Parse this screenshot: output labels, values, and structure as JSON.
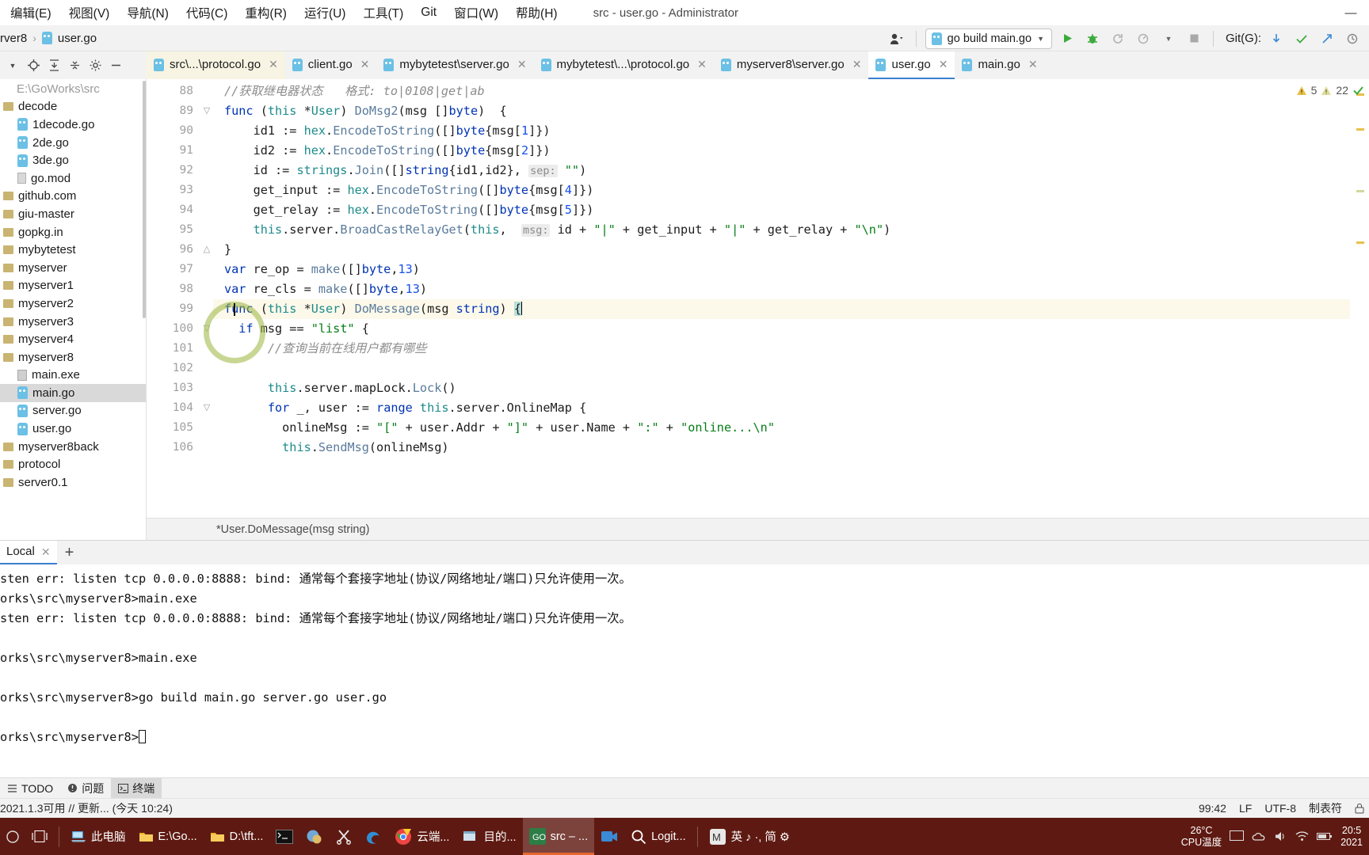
{
  "window": {
    "title": "src - user.go - Administrator",
    "minimize_label": "—",
    "maximize_label": "☐",
    "close_label": "✕"
  },
  "menubar": {
    "items": [
      {
        "label": "编辑(E)",
        "name": "menu-edit"
      },
      {
        "label": "视图(V)",
        "name": "menu-view"
      },
      {
        "label": "导航(N)",
        "name": "menu-navigate"
      },
      {
        "label": "代码(C)",
        "name": "menu-code"
      },
      {
        "label": "重构(R)",
        "name": "menu-refactor"
      },
      {
        "label": "运行(U)",
        "name": "menu-run"
      },
      {
        "label": "工具(T)",
        "name": "menu-tools"
      },
      {
        "label": "Git",
        "name": "menu-git"
      },
      {
        "label": "窗口(W)",
        "name": "menu-window"
      },
      {
        "label": "帮助(H)",
        "name": "menu-help"
      }
    ]
  },
  "navbar": {
    "breadcrumb": [
      {
        "label": "rver8",
        "name": "breadcrumb-project"
      },
      {
        "label": "user.go",
        "name": "breadcrumb-file"
      }
    ],
    "separator": "›",
    "run_config": "go build main.go",
    "run_config_caret": "▼",
    "git_label": "Git(G):",
    "actions": [
      "run-button",
      "debug-button",
      "rerun-button",
      "coverage-button",
      "more-caret",
      "stop-button"
    ],
    "git_actions": [
      "git-update-button",
      "git-commit-button",
      "git-push-button",
      "git-history-button"
    ]
  },
  "tabs": [
    {
      "label": "src\\...\\protocol.go",
      "state": "highlight",
      "name": "tab-src-protocol"
    },
    {
      "label": "client.go",
      "state": "normal",
      "name": "tab-client"
    },
    {
      "label": "mybytetest\\server.go",
      "state": "normal",
      "name": "tab-mybytetest-server"
    },
    {
      "label": "mybytetest\\...\\protocol.go",
      "state": "normal",
      "name": "tab-mybytetest-protocol"
    },
    {
      "label": "myserver8\\server.go",
      "state": "normal",
      "name": "tab-myserver8-server"
    },
    {
      "label": "user.go",
      "state": "active",
      "name": "tab-user"
    },
    {
      "label": "main.go",
      "state": "normal",
      "name": "tab-main"
    }
  ],
  "toolbar_icons": [
    "project-caret",
    "locate-icon",
    "expand-all-icon",
    "collapse-all-icon",
    "settings-icon",
    "hide-icon"
  ],
  "sidebar": {
    "root": "E:\\GoWorks\\src",
    "items": [
      {
        "label": "E:\\GoWorks\\src",
        "indent": 0,
        "icon": "root",
        "selected": false,
        "dim": true
      },
      {
        "label": "decode",
        "indent": 0,
        "icon": "folder",
        "selected": false
      },
      {
        "label": "1decode.go",
        "indent": 1,
        "icon": "go",
        "selected": false
      },
      {
        "label": "2de.go",
        "indent": 1,
        "icon": "go",
        "selected": false
      },
      {
        "label": "3de.go",
        "indent": 1,
        "icon": "go",
        "selected": false
      },
      {
        "label": "go.mod",
        "indent": 1,
        "icon": "mod",
        "selected": false
      },
      {
        "label": "github.com",
        "indent": 0,
        "icon": "folder",
        "selected": false
      },
      {
        "label": "giu-master",
        "indent": 0,
        "icon": "folder",
        "selected": false
      },
      {
        "label": "gopkg.in",
        "indent": 0,
        "icon": "folder",
        "selected": false
      },
      {
        "label": "mybytetest",
        "indent": 0,
        "icon": "folder",
        "selected": false
      },
      {
        "label": "myserver",
        "indent": 0,
        "icon": "folder",
        "selected": false
      },
      {
        "label": "myserver1",
        "indent": 0,
        "icon": "folder",
        "selected": false
      },
      {
        "label": "myserver2",
        "indent": 0,
        "icon": "folder",
        "selected": false
      },
      {
        "label": "myserver3",
        "indent": 0,
        "icon": "folder",
        "selected": false
      },
      {
        "label": "myserver4",
        "indent": 0,
        "icon": "folder",
        "selected": false
      },
      {
        "label": "myserver8",
        "indent": 0,
        "icon": "folder",
        "selected": false
      },
      {
        "label": "main.exe",
        "indent": 1,
        "icon": "exe",
        "selected": false
      },
      {
        "label": "main.go",
        "indent": 1,
        "icon": "go",
        "selected": true
      },
      {
        "label": "server.go",
        "indent": 1,
        "icon": "go",
        "selected": false
      },
      {
        "label": "user.go",
        "indent": 1,
        "icon": "go",
        "selected": false
      },
      {
        "label": "myserver8back",
        "indent": 0,
        "icon": "folder",
        "selected": false
      },
      {
        "label": "protocol",
        "indent": 0,
        "icon": "folder",
        "selected": false
      },
      {
        "label": "server0.1",
        "indent": 0,
        "icon": "folder",
        "selected": false
      }
    ]
  },
  "editor": {
    "first_line": 88,
    "lines": [
      {
        "n": 88,
        "fold": "",
        "tokens": [
          {
            "t": "//获取继电器状态   格式: to|0108|get|ab",
            "c": "cmt"
          }
        ]
      },
      {
        "n": 89,
        "fold": "open",
        "tokens": [
          {
            "t": "func ",
            "c": "kw"
          },
          {
            "t": "(",
            "c": ""
          },
          {
            "t": "this",
            "c": "this"
          },
          {
            "t": " *",
            "c": ""
          },
          {
            "t": "User",
            "c": "typ"
          },
          {
            "t": ") ",
            "c": ""
          },
          {
            "t": "DoMsg2",
            "c": "fn"
          },
          {
            "t": "(msg []",
            "c": ""
          },
          {
            "t": "byte",
            "c": "kw"
          },
          {
            "t": ")  {",
            "c": ""
          }
        ]
      },
      {
        "n": 90,
        "fold": "",
        "tokens": [
          {
            "t": "    id1 := ",
            "c": ""
          },
          {
            "t": "hex",
            "c": "typ"
          },
          {
            "t": ".",
            "c": ""
          },
          {
            "t": "EncodeToString",
            "c": "fn"
          },
          {
            "t": "([]",
            "c": ""
          },
          {
            "t": "byte",
            "c": "kw"
          },
          {
            "t": "{msg[",
            "c": ""
          },
          {
            "t": "1",
            "c": "num"
          },
          {
            "t": "]})",
            "c": ""
          }
        ]
      },
      {
        "n": 91,
        "fold": "",
        "tokens": [
          {
            "t": "    id2 := ",
            "c": ""
          },
          {
            "t": "hex",
            "c": "typ"
          },
          {
            "t": ".",
            "c": ""
          },
          {
            "t": "EncodeToString",
            "c": "fn"
          },
          {
            "t": "([]",
            "c": ""
          },
          {
            "t": "byte",
            "c": "kw"
          },
          {
            "t": "{msg[",
            "c": ""
          },
          {
            "t": "2",
            "c": "num"
          },
          {
            "t": "]})",
            "c": ""
          }
        ]
      },
      {
        "n": 92,
        "fold": "",
        "tokens": [
          {
            "t": "    id := ",
            "c": ""
          },
          {
            "t": "strings",
            "c": "typ"
          },
          {
            "t": ".",
            "c": ""
          },
          {
            "t": "Join",
            "c": "fn"
          },
          {
            "t": "([]",
            "c": ""
          },
          {
            "t": "string",
            "c": "kw"
          },
          {
            "t": "{id1,id2}, ",
            "c": ""
          },
          {
            "t": "sep:",
            "c": "hint"
          },
          {
            "t": " ",
            "c": ""
          },
          {
            "t": "\"\"",
            "c": "str"
          },
          {
            "t": ")",
            "c": ""
          }
        ]
      },
      {
        "n": 93,
        "fold": "",
        "tokens": [
          {
            "t": "    get_input := ",
            "c": ""
          },
          {
            "t": "hex",
            "c": "typ"
          },
          {
            "t": ".",
            "c": ""
          },
          {
            "t": "EncodeToString",
            "c": "fn"
          },
          {
            "t": "([]",
            "c": ""
          },
          {
            "t": "byte",
            "c": "kw"
          },
          {
            "t": "{msg[",
            "c": ""
          },
          {
            "t": "4",
            "c": "num"
          },
          {
            "t": "]})",
            "c": ""
          }
        ]
      },
      {
        "n": 94,
        "fold": "",
        "tokens": [
          {
            "t": "    get_relay := ",
            "c": ""
          },
          {
            "t": "hex",
            "c": "typ"
          },
          {
            "t": ".",
            "c": ""
          },
          {
            "t": "EncodeToString",
            "c": "fn"
          },
          {
            "t": "([]",
            "c": ""
          },
          {
            "t": "byte",
            "c": "kw"
          },
          {
            "t": "{msg[",
            "c": ""
          },
          {
            "t": "5",
            "c": "num"
          },
          {
            "t": "]})",
            "c": ""
          }
        ]
      },
      {
        "n": 95,
        "fold": "",
        "tokens": [
          {
            "t": "    ",
            "c": ""
          },
          {
            "t": "this",
            "c": "this"
          },
          {
            "t": ".server.",
            "c": ""
          },
          {
            "t": "BroadCastRelayGet",
            "c": "fn"
          },
          {
            "t": "(",
            "c": ""
          },
          {
            "t": "this",
            "c": "this"
          },
          {
            "t": ",  ",
            "c": ""
          },
          {
            "t": "msg:",
            "c": "hint"
          },
          {
            "t": " id + ",
            "c": ""
          },
          {
            "t": "\"|\"",
            "c": "str"
          },
          {
            "t": " + get_input + ",
            "c": ""
          },
          {
            "t": "\"|\"",
            "c": "str"
          },
          {
            "t": " + get_relay + ",
            "c": ""
          },
          {
            "t": "\"\\n\"",
            "c": "str"
          },
          {
            "t": ")",
            "c": ""
          }
        ]
      },
      {
        "n": 96,
        "fold": "close",
        "tokens": [
          {
            "t": "}",
            "c": ""
          }
        ]
      },
      {
        "n": 97,
        "fold": "",
        "tokens": [
          {
            "t": "var ",
            "c": "kw"
          },
          {
            "t": "re_op = ",
            "c": ""
          },
          {
            "t": "make",
            "c": "fn"
          },
          {
            "t": "([]",
            "c": ""
          },
          {
            "t": "byte",
            "c": "kw"
          },
          {
            "t": ",",
            "c": ""
          },
          {
            "t": "13",
            "c": "num"
          },
          {
            "t": ")",
            "c": ""
          }
        ]
      },
      {
        "n": 98,
        "fold": "",
        "tokens": [
          {
            "t": "var ",
            "c": "kw"
          },
          {
            "t": "re_cls = ",
            "c": ""
          },
          {
            "t": "make",
            "c": "fn"
          },
          {
            "t": "([]",
            "c": ""
          },
          {
            "t": "byte",
            "c": "kw"
          },
          {
            "t": ",",
            "c": ""
          },
          {
            "t": "13",
            "c": "num"
          },
          {
            "t": ")",
            "c": ""
          }
        ]
      },
      {
        "n": 99,
        "fold": "",
        "current": true,
        "tokens": [
          {
            "t": "func ",
            "c": "kw"
          },
          {
            "t": "(",
            "c": ""
          },
          {
            "t": "this",
            "c": "this"
          },
          {
            "t": " *",
            "c": ""
          },
          {
            "t": "User",
            "c": "typ"
          },
          {
            "t": ") ",
            "c": ""
          },
          {
            "t": "DoMessage",
            "c": "fn"
          },
          {
            "t": "(msg ",
            "c": ""
          },
          {
            "t": "string",
            "c": "kw"
          },
          {
            "t": ") ",
            "c": ""
          },
          {
            "t": "{",
            "c": "selbr"
          }
        ]
      },
      {
        "n": 100,
        "fold": "open",
        "tokens": [
          {
            "t": "  ",
            "c": ""
          },
          {
            "t": "if ",
            "c": "kw"
          },
          {
            "t": "msg == ",
            "c": ""
          },
          {
            "t": "\"list\"",
            "c": "str"
          },
          {
            "t": " {",
            "c": ""
          }
        ]
      },
      {
        "n": 101,
        "fold": "",
        "tokens": [
          {
            "t": "      ",
            "c": ""
          },
          {
            "t": "//查询当前在线用户都有哪些",
            "c": "cmt"
          }
        ]
      },
      {
        "n": 102,
        "fold": "",
        "tokens": [
          {
            "t": "",
            "c": ""
          }
        ]
      },
      {
        "n": 103,
        "fold": "",
        "tokens": [
          {
            "t": "      ",
            "c": ""
          },
          {
            "t": "this",
            "c": "this"
          },
          {
            "t": ".server.mapLock.",
            "c": ""
          },
          {
            "t": "Lock",
            "c": "fn"
          },
          {
            "t": "()",
            "c": ""
          }
        ]
      },
      {
        "n": 104,
        "fold": "open",
        "tokens": [
          {
            "t": "      ",
            "c": ""
          },
          {
            "t": "for ",
            "c": "kw"
          },
          {
            "t": "_, user := ",
            "c": ""
          },
          {
            "t": "range ",
            "c": "kw"
          },
          {
            "t": "this",
            "c": "this"
          },
          {
            "t": ".server.OnlineMap {",
            "c": ""
          }
        ]
      },
      {
        "n": 105,
        "fold": "",
        "tokens": [
          {
            "t": "        onlineMsg := ",
            "c": ""
          },
          {
            "t": "\"[\"",
            "c": "str"
          },
          {
            "t": " + user.Addr + ",
            "c": ""
          },
          {
            "t": "\"]\"",
            "c": "str"
          },
          {
            "t": " + user.Name + ",
            "c": ""
          },
          {
            "t": "\":\"",
            "c": "str"
          },
          {
            "t": " + ",
            "c": ""
          },
          {
            "t": "\"online...\\n\"",
            "c": "str"
          }
        ]
      },
      {
        "n": 106,
        "fold": "",
        "tokens": [
          {
            "t": "        ",
            "c": ""
          },
          {
            "t": "this",
            "c": "this"
          },
          {
            "t": ".",
            "c": ""
          },
          {
            "t": "SendMsg",
            "c": "fn"
          },
          {
            "t": "(onlineMsg)",
            "c": ""
          }
        ]
      }
    ],
    "breadcrumb": "*User.DoMessage(msg string)",
    "inspections": {
      "warning_count": "5",
      "weak_warning_count": "22",
      "warning_icon": "warning-triangle",
      "ok_icon": "check-mark"
    }
  },
  "terminal": {
    "tabs": [
      {
        "label": "Local",
        "active": true,
        "name": "terminal-tab-local"
      }
    ],
    "add_label": "+",
    "lines": [
      "sten err: listen tcp 0.0.0.0:8888: bind: 通常每个套接字地址(协议/网络地址/端口)只允许使用一次。",
      "orks\\src\\myserver8>main.exe",
      "sten err: listen tcp 0.0.0.0:8888: bind: 通常每个套接字地址(协议/网络地址/端口)只允许使用一次。",
      "",
      "orks\\src\\myserver8>main.exe",
      "",
      "orks\\src\\myserver8>go build main.go server.go user.go",
      "",
      "orks\\src\\myserver8>"
    ]
  },
  "toolwindows": [
    {
      "label": "TODO",
      "icon": "todo-icon",
      "active": false,
      "name": "toolwindow-todo"
    },
    {
      "label": "问题",
      "icon": "problems-icon",
      "active": false,
      "name": "toolwindow-problems"
    },
    {
      "label": "终端",
      "icon": "terminal-icon",
      "active": true,
      "name": "toolwindow-terminal"
    }
  ],
  "statusbar": {
    "left": "2021.1.3可用 // 更新... (今天 10:24)",
    "caret_position": "99:42",
    "line_separator": "LF",
    "encoding": "UTF-8",
    "indent": "制表符",
    "lock_icon": "lock-icon"
  },
  "taskbar": {
    "items": [
      {
        "label": "",
        "icon": "task-view-icon",
        "name": "taskbar-taskview"
      },
      {
        "label": "此电脑",
        "icon": "computer-icon",
        "name": "taskbar-this-pc"
      },
      {
        "label": "E:\\Go...",
        "icon": "folder-icon",
        "name": "taskbar-folder-e"
      },
      {
        "label": "D:\\tft...",
        "icon": "folder-icon",
        "name": "taskbar-folder-d"
      },
      {
        "label": "",
        "icon": "console-icon",
        "name": "taskbar-console"
      },
      {
        "label": "",
        "icon": "blue-app-icon",
        "name": "taskbar-blue-app"
      },
      {
        "label": "",
        "icon": "scissors-icon",
        "name": "taskbar-snip"
      },
      {
        "label": "",
        "icon": "edge-icon",
        "name": "taskbar-edge"
      },
      {
        "label": "云端...",
        "icon": "chrome-icon",
        "name": "taskbar-chrome"
      },
      {
        "label": "目的...",
        "icon": "window-icon",
        "name": "taskbar-window"
      },
      {
        "label": "src – ...",
        "icon": "goland-icon",
        "name": "taskbar-goland",
        "active": true
      },
      {
        "label": "",
        "icon": "video-icon",
        "name": "taskbar-video"
      },
      {
        "label": "Logit...",
        "icon": "search-icon",
        "name": "taskbar-logi"
      },
      {
        "label": "英 ♪ ·, 简 ⚙",
        "icon": "ime-icon",
        "name": "taskbar-ime"
      }
    ],
    "temperature": "26°C",
    "temperature_label": "CPU温度",
    "clock_time": "20:5",
    "clock_date": "2021"
  }
}
